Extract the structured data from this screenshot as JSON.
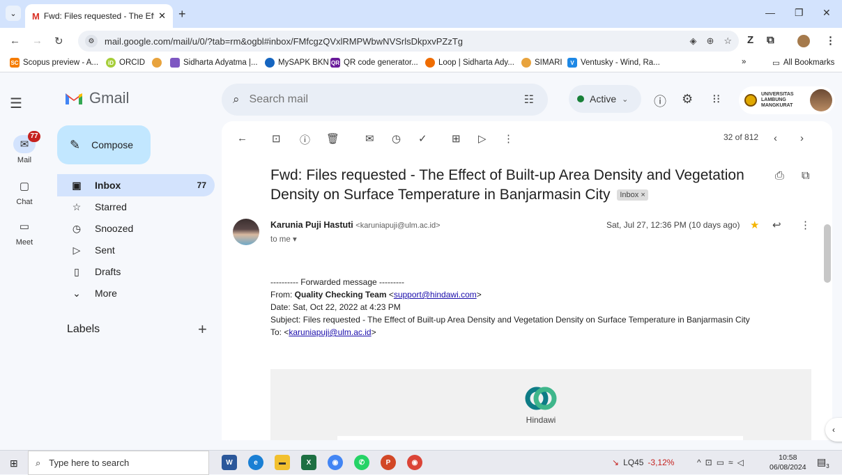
{
  "browser": {
    "tab_title": "Fwd: Files requested - The Effec",
    "url": "mail.google.com/mail/u/0/?tab=rm&ogbl#inbox/FMfcgzQVxlRMPWbwNVSrlsDkpxvPZzTg",
    "bookmarks": [
      {
        "label": "Scopus preview - A...",
        "color": "#f57c00",
        "glyph": "SC"
      },
      {
        "label": "ORCID",
        "color": "#a6ce39",
        "glyph": "iD"
      },
      {
        "label": "",
        "color": "#e8a33d",
        "glyph": ""
      },
      {
        "label": "Sidharta Adyatma |...",
        "color": "#7e57c2",
        "glyph": ""
      },
      {
        "label": "MySAPK BKN",
        "color": "#1565c0",
        "glyph": ""
      },
      {
        "label": "QR code generator...",
        "color": "#6a1b9a",
        "glyph": "QR"
      },
      {
        "label": "Loop | Sidharta Ady...",
        "color": "#ef6c00",
        "glyph": ""
      },
      {
        "label": "SIMARI",
        "color": "#e8a33d",
        "glyph": ""
      },
      {
        "label": "Ventusky - Wind, Ra...",
        "color": "#1e88e5",
        "glyph": "V"
      }
    ],
    "all_bookmarks": "All Bookmarks"
  },
  "gmail": {
    "logo_text": "Gmail",
    "search_placeholder": "Search mail",
    "status": "Active",
    "org_name": "UNIVERSITAS LAMBUNG MANGKURAT",
    "rail": {
      "mail": "Mail",
      "mail_badge": "77",
      "chat": "Chat",
      "meet": "Meet"
    },
    "compose": "Compose",
    "folders": [
      {
        "label": "Inbox",
        "icon": "inbox-icon",
        "count": "77"
      },
      {
        "label": "Starred",
        "icon": "star-icon",
        "count": ""
      },
      {
        "label": "Snoozed",
        "icon": "clock-icon",
        "count": ""
      },
      {
        "label": "Sent",
        "icon": "send-icon",
        "count": ""
      },
      {
        "label": "Drafts",
        "icon": "draft-icon",
        "count": ""
      },
      {
        "label": "More",
        "icon": "chevron-down-icon",
        "count": ""
      }
    ],
    "labels_heading": "Labels"
  },
  "email": {
    "page_info": "32 of 812",
    "subject": "Fwd: Files requested - The Effect of Built-up Area Density and Vegetation Density on Surface Temperature in Banjarmasin City",
    "label_chip": "Inbox ×",
    "sender_name": "Karunia Puji Hastuti",
    "sender_email": "<karuniapuji@ulm.ac.id>",
    "to_me": "to me ▾",
    "date": "Sat, Jul 27, 12:36 PM (10 days ago)",
    "body": {
      "forwarded": "---------- Forwarded message ---------",
      "from_prefix": "From: ",
      "from_name": "Quality Checking Team",
      "from_email_open": " <",
      "from_email": "support@hindawi.com",
      "from_email_close": ">",
      "date_line": "Date: Sat, Oct 22, 2022 at 4:23 PM",
      "subject_line": "Subject: Files requested - The Effect of Built-up Area Density and Vegetation Density on Surface Temperature in Banjarmasin City",
      "to_prefix": "To: <",
      "to_email": "karuniapuji@ulm.ac.id",
      "to_suffix": ">"
    },
    "brand": "Hindawi"
  },
  "taskbar": {
    "search_placeholder": "Type here to search",
    "stock_name": "LQ45",
    "stock_change": "-3,12%",
    "time": "10:58",
    "date": "06/08/2024",
    "notif_count": "3"
  }
}
